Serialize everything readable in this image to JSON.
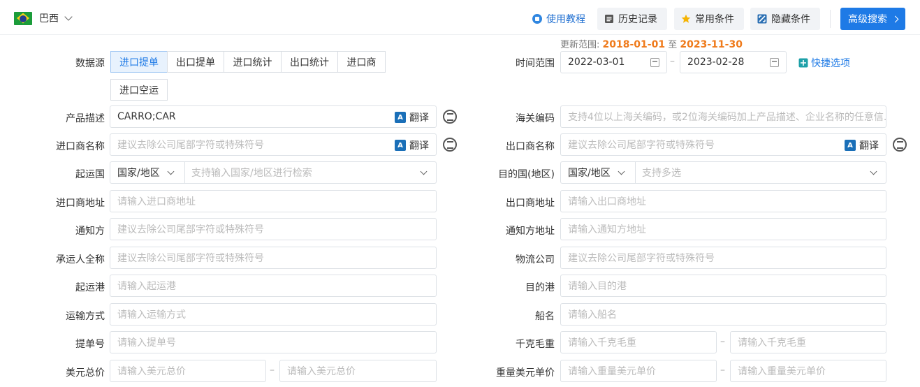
{
  "topbar": {
    "country": "巴西",
    "tutorial": "使用教程",
    "history": "历史记录",
    "favorites": "常用条件",
    "hide": "隐藏条件",
    "advanced": "高级搜索"
  },
  "range_note": {
    "prefix": "更新范围:",
    "start": "2018-01-01",
    "mid": "至",
    "end": "2023-11-30"
  },
  "labels": {
    "datasource": "数据源",
    "time_range": "时间范围",
    "product_desc": "产品描述",
    "hs_code": "海关编码",
    "importer": "进口商名称",
    "exporter": "出口商名称",
    "origin": "起运国",
    "dest": "目的国(地区)",
    "importer_addr": "进口商地址",
    "exporter_addr": "出口商地址",
    "notify": "通知方",
    "notify_addr": "通知方地址",
    "carrier": "承运人全称",
    "logistics": "物流公司",
    "pol": "起运港",
    "pod": "目的港",
    "transport": "运输方式",
    "vessel": "船名",
    "bl": "提单号",
    "gross_weight": "千克毛重",
    "usd_total": "美元总价",
    "weight_usd_unit": "重量美元单价"
  },
  "datasource_tabs": [
    "进口提单",
    "出口提单",
    "进口统计",
    "出口统计",
    "进口商",
    "进口空运"
  ],
  "dates": {
    "start": "2022-03-01",
    "end": "2023-02-28"
  },
  "quick_options": "快捷选项",
  "translate": "翻译",
  "product_value": "CARRO;CAR",
  "country_select": "国家/地区",
  "placeholders": {
    "hs_code": "支持4位以上海关编码，或2位海关编码加上产品描述、企业名称的任意信...",
    "company": "建议去除公司尾部字符或特殊符号",
    "origin_search": "支持输入国家/地区进行检索",
    "dest_multi": "支持多选",
    "importer_addr": "请输入进口商地址",
    "exporter_addr": "请输入出口商地址",
    "notify_addr": "请输入通知方地址",
    "pol": "请输入起运港",
    "pod": "请输入目的港",
    "transport": "请输入运输方式",
    "vessel": "请输入船名",
    "bl": "请输入提单号",
    "gross_weight": "请输入千克毛重",
    "usd_total": "请输入美元总价",
    "weight_usd_unit": "请输入重量美元单价"
  }
}
